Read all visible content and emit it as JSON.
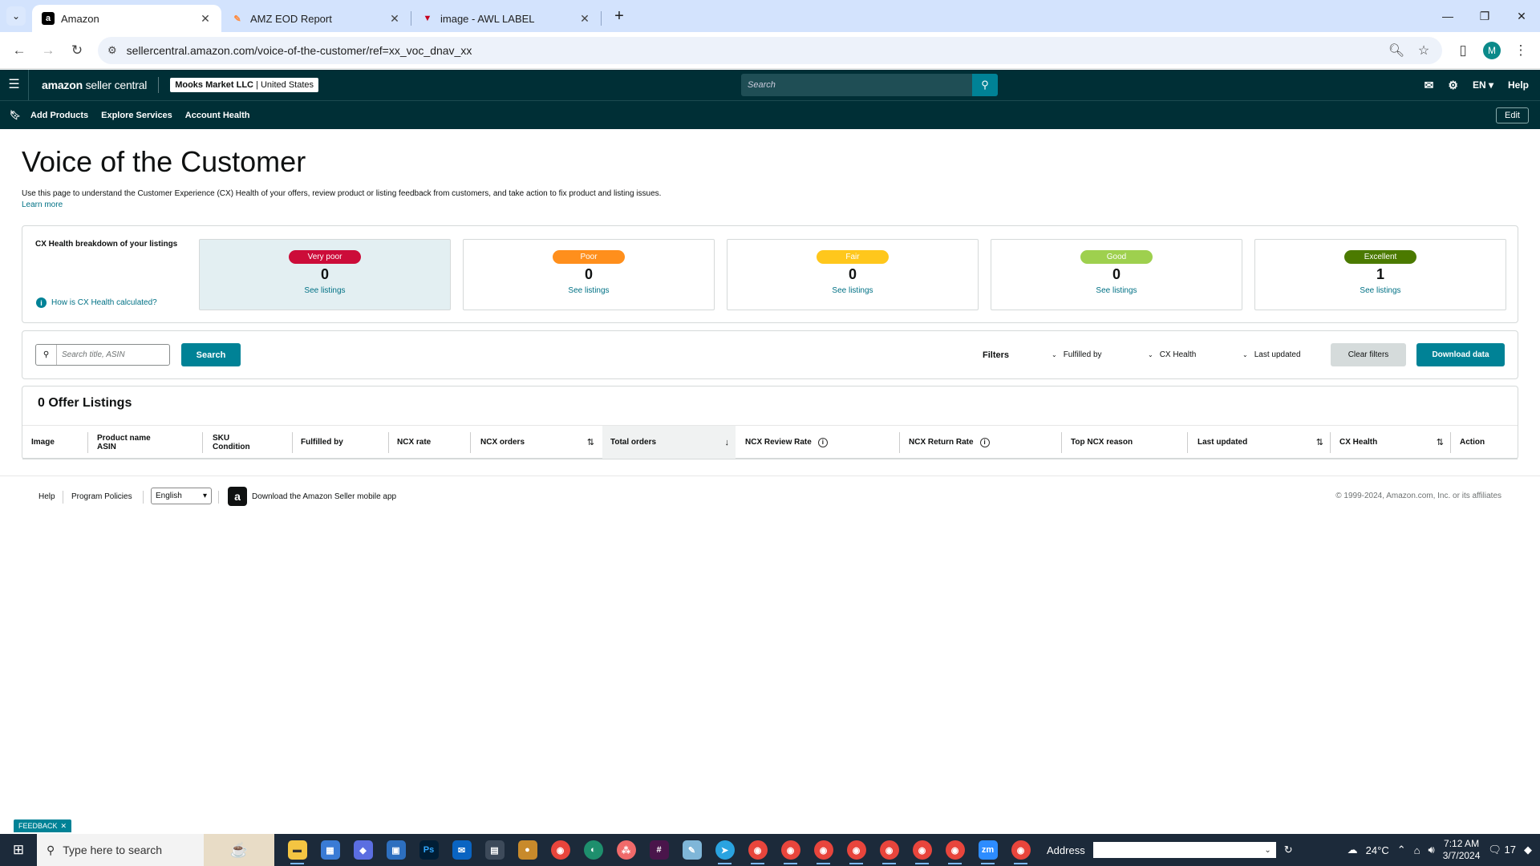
{
  "browser": {
    "tabs": [
      {
        "title": "Amazon",
        "favicon": "a",
        "favicon_bg": "#000000",
        "active": true
      },
      {
        "title": "AMZ EOD Report",
        "favicon": "✎",
        "favicon_bg": "#ff8a3d",
        "active": false
      },
      {
        "title": "image - AWL LABEL",
        "favicon": "▼",
        "favicon_bg": "#c6001e",
        "active": false
      }
    ],
    "url": "sellercentral.amazon.com/voice-of-the-customer/ref=xx_voc_dnav_xx",
    "profile_initial": "M"
  },
  "header": {
    "logo_bold": "amazon",
    "logo_light": " seller central",
    "account_bold": "Mooks Market LLC",
    "account_light": " | United States",
    "search_placeholder": "Search",
    "language": "EN",
    "help": "Help"
  },
  "nav": {
    "links": [
      "Add Products",
      "Explore Services",
      "Account Health"
    ],
    "edit": "Edit"
  },
  "page": {
    "title": "Voice of the Customer",
    "intro": "Use this page to understand the Customer Experience (CX) Health of your offers, review product or listing feedback from customers, and take action to fix product and listing issues.",
    "learn_more": "Learn more"
  },
  "cx": {
    "label": "CX Health breakdown of your listings",
    "how_link": "How is CX Health calculated?",
    "cards": [
      {
        "label": "Very poor",
        "count": "0",
        "link": "See listings",
        "color": "#cc0c39"
      },
      {
        "label": "Poor",
        "count": "0",
        "link": "See listings",
        "color": "#ff8f1c"
      },
      {
        "label": "Fair",
        "count": "0",
        "link": "See listings",
        "color": "#ffc71c"
      },
      {
        "label": "Good",
        "count": "0",
        "link": "See listings",
        "color": "#9ed04e"
      },
      {
        "label": "Excellent",
        "count": "1",
        "link": "See listings",
        "color": "#4b7a00"
      }
    ]
  },
  "filters": {
    "search_placeholder": "Search title, ASIN",
    "search_button": "Search",
    "label": "Filters",
    "dropdowns": [
      "Fulfilled by",
      "CX Health",
      "Last updated"
    ],
    "clear": "Clear filters",
    "download": "Download data"
  },
  "table": {
    "title": "0 Offer Listings",
    "columns": [
      {
        "line1": "Image",
        "line2": ""
      },
      {
        "line1": "Product name",
        "line2": "ASIN"
      },
      {
        "line1": "SKU",
        "line2": "Condition"
      },
      {
        "line1": "Fulfilled by",
        "line2": ""
      },
      {
        "line1": "NCX rate",
        "line2": ""
      },
      {
        "line1": "NCX orders",
        "line2": ""
      },
      {
        "line1": "Total orders",
        "line2": ""
      },
      {
        "line1": "NCX Review Rate",
        "line2": ""
      },
      {
        "line1": "NCX Return Rate",
        "line2": ""
      },
      {
        "line1": "Top NCX reason",
        "line2": ""
      },
      {
        "line1": "Last updated",
        "line2": ""
      },
      {
        "line1": "CX Health",
        "line2": ""
      },
      {
        "line1": "Action",
        "line2": ""
      }
    ]
  },
  "footer": {
    "help": "Help",
    "policies": "Program Policies",
    "language": "English",
    "app_text": "Download the Amazon Seller mobile app",
    "copyright": "© 1999-2024, Amazon.com, Inc. or its affiliates"
  },
  "feedback": "FEEDBACK",
  "taskbar": {
    "search_placeholder": "Type here to search",
    "address_label": "Address",
    "temperature": "24°C",
    "time": "7:12 AM",
    "date": "3/7/2024",
    "notifications": "17"
  }
}
